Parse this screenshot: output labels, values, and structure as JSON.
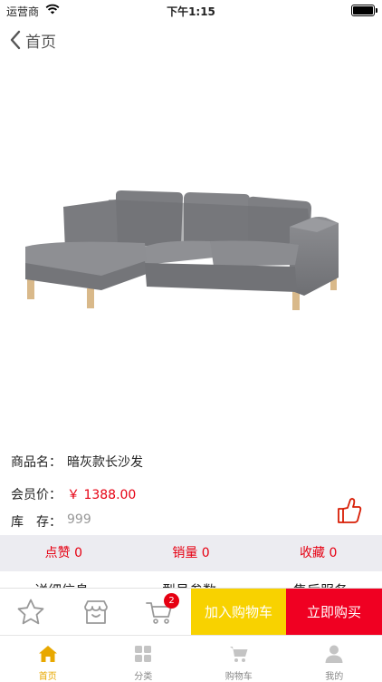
{
  "status_bar": {
    "carrier": "运营商",
    "time": "下午1:15"
  },
  "nav": {
    "back_label": "首页"
  },
  "product": {
    "name_key": "商品名：",
    "name": "暗灰款长沙发",
    "price_key": "会员价：",
    "price": "￥ 1388.00",
    "stock_key": "库　存：",
    "stock": "999"
  },
  "stats": {
    "likes": "点赞 0",
    "sales": "销量 0",
    "favorites": "收藏 0"
  },
  "detail_tabs": [
    "详细信息",
    "型号参数",
    "售后服务"
  ],
  "action_bar": {
    "cart_badge": "2",
    "add_to_cart": "加入购物车",
    "buy_now": "立即购买"
  },
  "tab_bar": {
    "items": [
      {
        "label": "首页",
        "icon": "home-icon"
      },
      {
        "label": "分类",
        "icon": "category-icon"
      },
      {
        "label": "购物车",
        "icon": "cart-icon"
      },
      {
        "label": "我的",
        "icon": "profile-icon"
      }
    ]
  },
  "colors": {
    "accent_yellow": "#f8d200",
    "accent_red": "#f00022",
    "price_red": "#e60012",
    "active_tab": "#e8a800"
  }
}
